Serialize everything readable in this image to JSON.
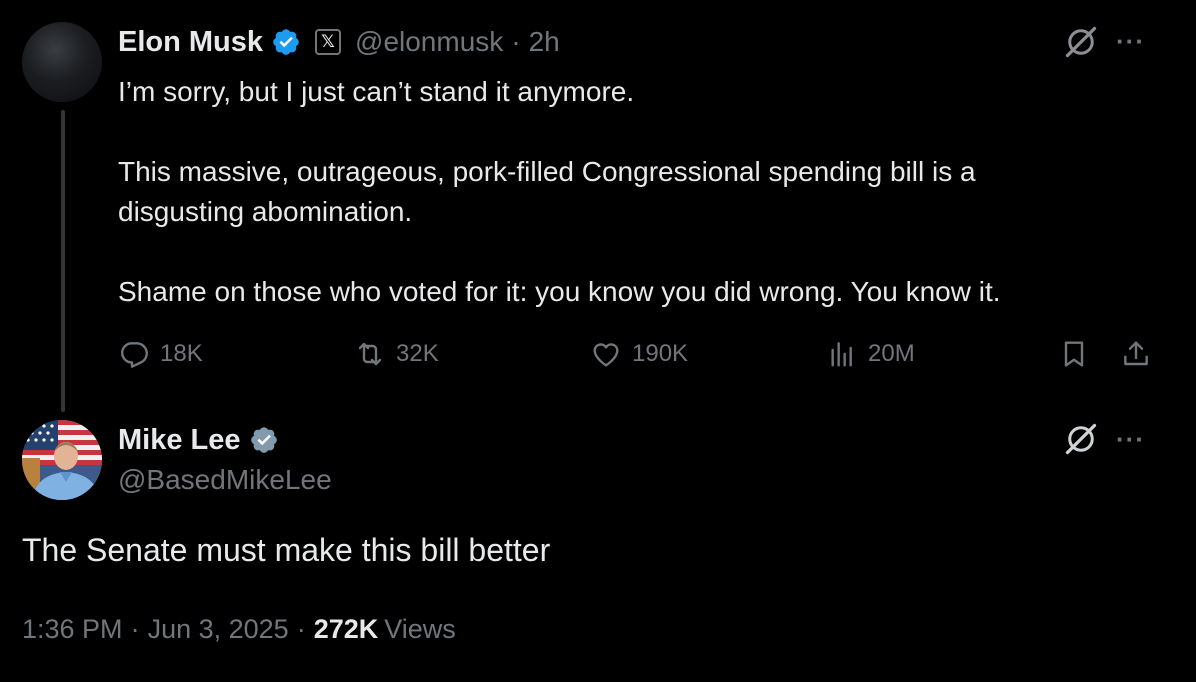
{
  "tweet": {
    "author_name": "Elon Musk",
    "x_badge": "𝕏",
    "handle": "@elonmusk",
    "separator": "·",
    "age": "2h",
    "lines": [
      "I’m sorry, but I just can’t stand it anymore.",
      "This massive, outrageous, pork-filled Congressional spending bill is a",
      "disgusting abomination.",
      "Shame on those who voted for it: you know you did wrong. You know it."
    ],
    "actions": {
      "replies": "18K",
      "reposts": "32K",
      "likes": "190K",
      "views": "20M"
    },
    "more": "···"
  },
  "reply": {
    "author_name": "Mike Lee",
    "handle": "@BasedMikeLee",
    "text": "The Senate must make this bill better",
    "more": "···",
    "meta": {
      "time": "1:36 PM",
      "sep1": "·",
      "date": "Jun 3, 2025",
      "sep2": "·",
      "views_count": "272K",
      "views_label": "Views"
    }
  },
  "colors": {
    "background": "#000000",
    "text": "#e7e9ea",
    "muted": "#71767b",
    "verified": "#1d9bf0"
  },
  "icons": [
    "verified-badge-icon",
    "x-affiliate-icon",
    "grok-icon",
    "more-icon",
    "reply-icon",
    "repost-icon",
    "like-icon",
    "views-icon",
    "bookmark-icon",
    "share-icon"
  ]
}
